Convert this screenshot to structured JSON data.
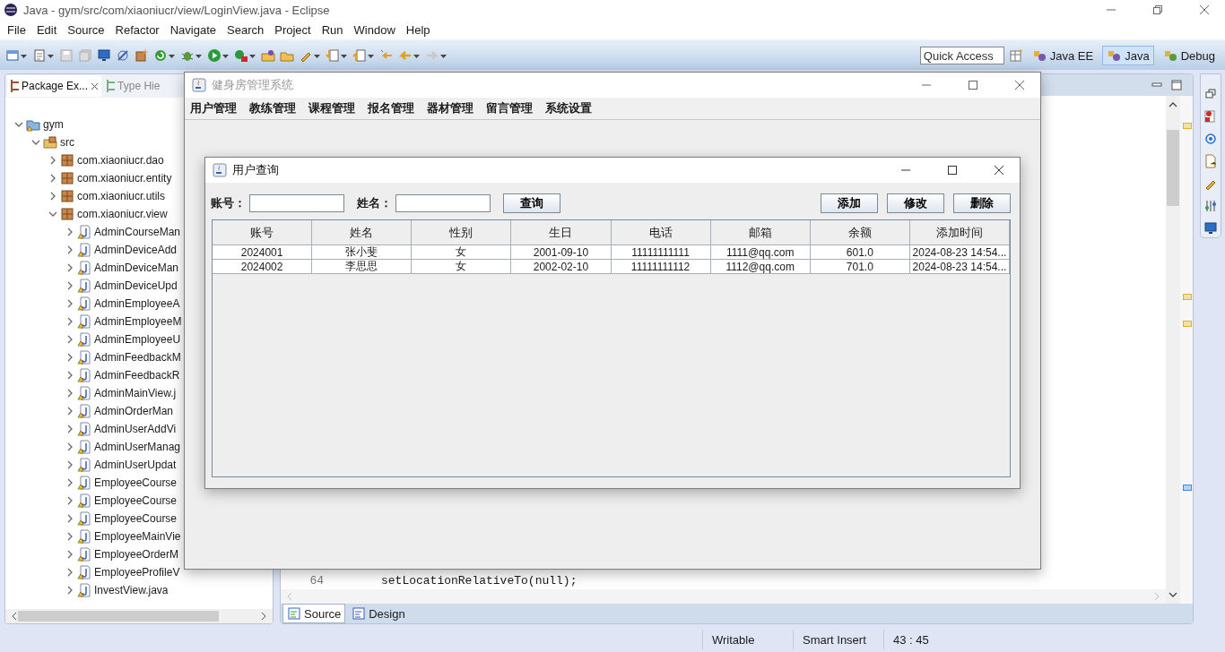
{
  "window": {
    "title": "Java - gym/src/com/xiaoniucr/view/LoginView.java - Eclipse"
  },
  "menu": [
    "File",
    "Edit",
    "Source",
    "Refactor",
    "Navigate",
    "Search",
    "Project",
    "Run",
    "Window",
    "Help"
  ],
  "quick_access": {
    "placeholder": "Quick Access"
  },
  "perspectives": [
    {
      "label": "Java EE",
      "selected": false
    },
    {
      "label": "Java",
      "selected": true
    },
    {
      "label": "Debug",
      "selected": false
    }
  ],
  "package_explorer": {
    "tabs": [
      {
        "label": "Package Ex...",
        "selected": true
      },
      {
        "label": "Type Hie",
        "selected": false
      }
    ],
    "tree": [
      {
        "label": "gym",
        "kind": "project",
        "expanded": true,
        "children": [
          {
            "label": "src",
            "kind": "folder",
            "expanded": true,
            "children": [
              {
                "label": "com.xiaoniucr.dao",
                "kind": "package",
                "expanded": false
              },
              {
                "label": "com.xiaoniucr.entity",
                "kind": "package",
                "expanded": false
              },
              {
                "label": "com.xiaoniucr.utils",
                "kind": "package",
                "expanded": false
              },
              {
                "label": "com.xiaoniucr.view",
                "kind": "package",
                "expanded": true,
                "children": [
                  {
                    "label": "AdminCourseMan",
                    "kind": "file",
                    "expanded": false
                  },
                  {
                    "label": "AdminDeviceAdd",
                    "kind": "file",
                    "expanded": false
                  },
                  {
                    "label": "AdminDeviceMan",
                    "kind": "file",
                    "expanded": false
                  },
                  {
                    "label": "AdminDeviceUpd",
                    "kind": "file",
                    "expanded": false
                  },
                  {
                    "label": "AdminEmployeeA",
                    "kind": "file",
                    "expanded": false
                  },
                  {
                    "label": "AdminEmployeeM",
                    "kind": "file",
                    "expanded": false
                  },
                  {
                    "label": "AdminEmployeeU",
                    "kind": "file",
                    "expanded": false
                  },
                  {
                    "label": "AdminFeedbackM",
                    "kind": "file",
                    "expanded": false
                  },
                  {
                    "label": "AdminFeedbackR",
                    "kind": "file",
                    "expanded": false
                  },
                  {
                    "label": "AdminMainView.j",
                    "kind": "file",
                    "expanded": false
                  },
                  {
                    "label": "AdminOrderMan",
                    "kind": "file",
                    "expanded": false
                  },
                  {
                    "label": "AdminUserAddVi",
                    "kind": "file",
                    "expanded": false
                  },
                  {
                    "label": "AdminUserManag",
                    "kind": "file",
                    "expanded": false
                  },
                  {
                    "label": "AdminUserUpdat",
                    "kind": "file",
                    "expanded": false
                  },
                  {
                    "label": "EmployeeCourse",
                    "kind": "file",
                    "expanded": false
                  },
                  {
                    "label": "EmployeeCourse",
                    "kind": "file",
                    "expanded": false
                  },
                  {
                    "label": "EmployeeCourse",
                    "kind": "file",
                    "expanded": false
                  },
                  {
                    "label": "EmployeeMainVie",
                    "kind": "file",
                    "expanded": false
                  },
                  {
                    "label": "EmployeeOrderM",
                    "kind": "file",
                    "expanded": false
                  },
                  {
                    "label": "EmployeeProfileV",
                    "kind": "file",
                    "expanded": false
                  },
                  {
                    "label": "InvestView.java",
                    "kind": "file",
                    "expanded": false
                  }
                ]
              }
            ]
          }
        ]
      }
    ]
  },
  "editor": {
    "line_number": "64",
    "code": "setLocationRelativeTo(null);",
    "tabs": [
      {
        "label": "Source",
        "selected": true
      },
      {
        "label": "Design",
        "selected": false
      }
    ]
  },
  "status_bar": [
    "Writable",
    "Smart Insert",
    "43 : 45"
  ],
  "app_window": {
    "title": "健身房管理系统",
    "menu": [
      "用户管理",
      "教练管理",
      "课程管理",
      "报名管理",
      "器材管理",
      "留言管理",
      "系统设置"
    ]
  },
  "dialog": {
    "title": "用户查询",
    "fields": [
      {
        "label": "账号："
      },
      {
        "label": "姓名："
      }
    ],
    "search_button": "查询",
    "actions": [
      "添加",
      "修改",
      "删除"
    ],
    "table": {
      "columns": [
        "账号",
        "姓名",
        "性别",
        "生日",
        "电话",
        "邮箱",
        "余额",
        "添加时间"
      ],
      "rows": [
        [
          "2024001",
          "张小斐",
          "女",
          "2001-09-10",
          "11111111111",
          "1111@qq.com",
          "601.0",
          "2024-08-23 14:54..."
        ],
        [
          "2024002",
          "李思思",
          "女",
          "2002-02-10",
          "11111111112",
          "1112@qq.com",
          "701.0",
          "2024-08-23 14:54..."
        ]
      ]
    }
  }
}
